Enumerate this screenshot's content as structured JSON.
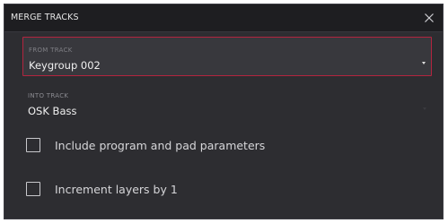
{
  "dialog": {
    "title": "MERGE TRACKS",
    "close_icon": "close-icon"
  },
  "from_track": {
    "label": "FROM TRACK",
    "value": "Keygroup 002",
    "icon": "dropdown-caret-icon",
    "accent_color": "#b3243f"
  },
  "into_track": {
    "label": "INTO TRACK",
    "value": "OSK Bass",
    "icon": "dropdown-caret-icon"
  },
  "options": [
    {
      "label": "Include program and pad parameters",
      "checked": false
    },
    {
      "label": "Increment layers by 1",
      "checked": false
    }
  ]
}
